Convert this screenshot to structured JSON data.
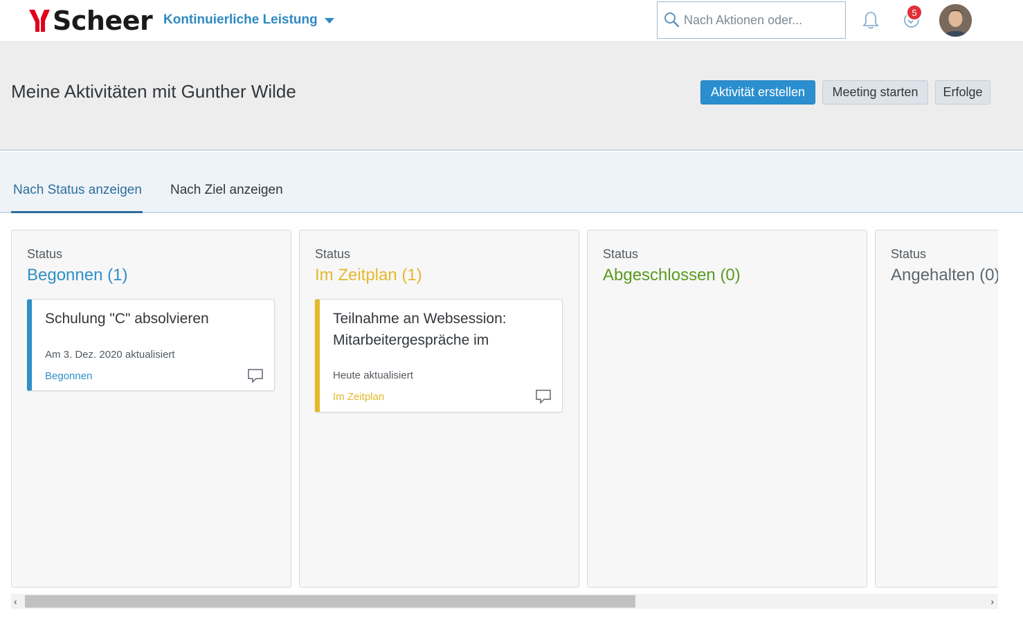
{
  "header": {
    "logo_text": "Scheer",
    "app_title": "Kontinuierliche Leistung",
    "search_placeholder": "Nach Aktionen oder...",
    "badge_count": "5"
  },
  "page": {
    "title": "Meine Aktivitäten mit Gunther Wilde",
    "buttons": {
      "create": "Aktivität erstellen",
      "meeting": "Meeting starten",
      "achievements": "Erfolge"
    }
  },
  "tabs": [
    {
      "label": "Nach Status anzeigen",
      "selected": true
    },
    {
      "label": "Nach Ziel anzeigen",
      "selected": false
    }
  ],
  "columns": [
    {
      "label": "Status",
      "title": "Begonnen (1)",
      "color": "#2f8fc7",
      "cards": [
        {
          "title": "Schulung \"C\" absolvieren",
          "updated": "Am 3. Dez. 2020 aktualisiert",
          "status": "Begonnen"
        }
      ]
    },
    {
      "label": "Status",
      "title": "Im Zeitplan (1)",
      "color": "#e3b92b",
      "cards": [
        {
          "title": "Teilnahme an Websession: Mitarbeitergespräche im",
          "updated": "Heute aktualisiert",
          "status": "Im Zeitplan"
        }
      ]
    },
    {
      "label": "Status",
      "title": "Abgeschlossen (0)",
      "color": "#5a9a1f",
      "cards": []
    },
    {
      "label": "Status",
      "title": "Angehalten (0)",
      "color": "#5b6670",
      "cards": []
    }
  ],
  "scroll": {
    "arrow_left": "‹",
    "arrow_right": "›"
  },
  "colors": {
    "brand_red": "#e2001a",
    "accent_blue": "#2b8fcf",
    "tab_blue": "#2e6d9c"
  }
}
